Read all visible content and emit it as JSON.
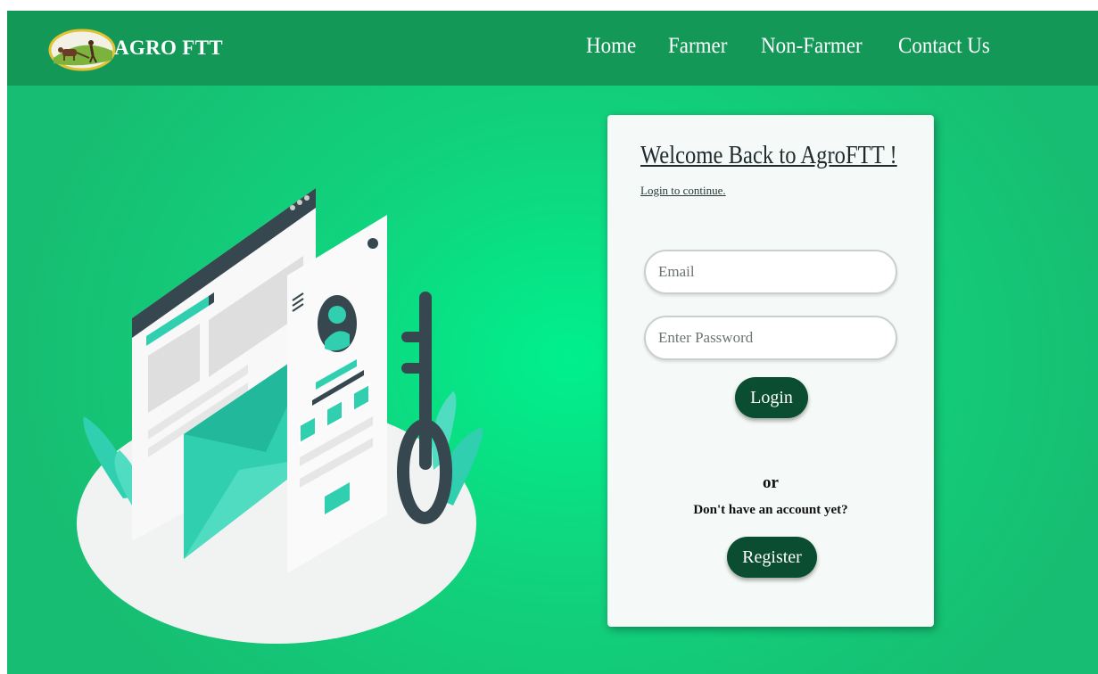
{
  "brand": {
    "name": "AGRO FTT",
    "logo_icon": "farmer-plough-logo"
  },
  "nav": {
    "items": [
      {
        "label": "Home"
      },
      {
        "label": "Farmer"
      },
      {
        "label": "Non-Farmer"
      },
      {
        "label": "Contact Us"
      }
    ]
  },
  "login": {
    "title": "Welcome Back to AgroFTT !",
    "subtitle": "Login to continue.",
    "email_placeholder": "Email",
    "password_placeholder": "Enter Password",
    "login_label": "Login",
    "or_label": "or",
    "no_account_label": "Don't have an account yet?",
    "register_label": "Register"
  },
  "illustration": {
    "icon": "secure-login-illustration"
  },
  "colors": {
    "navbar": "#149858",
    "background": "#10d47e",
    "button": "#0b4d30",
    "card": "#f5faf8"
  }
}
